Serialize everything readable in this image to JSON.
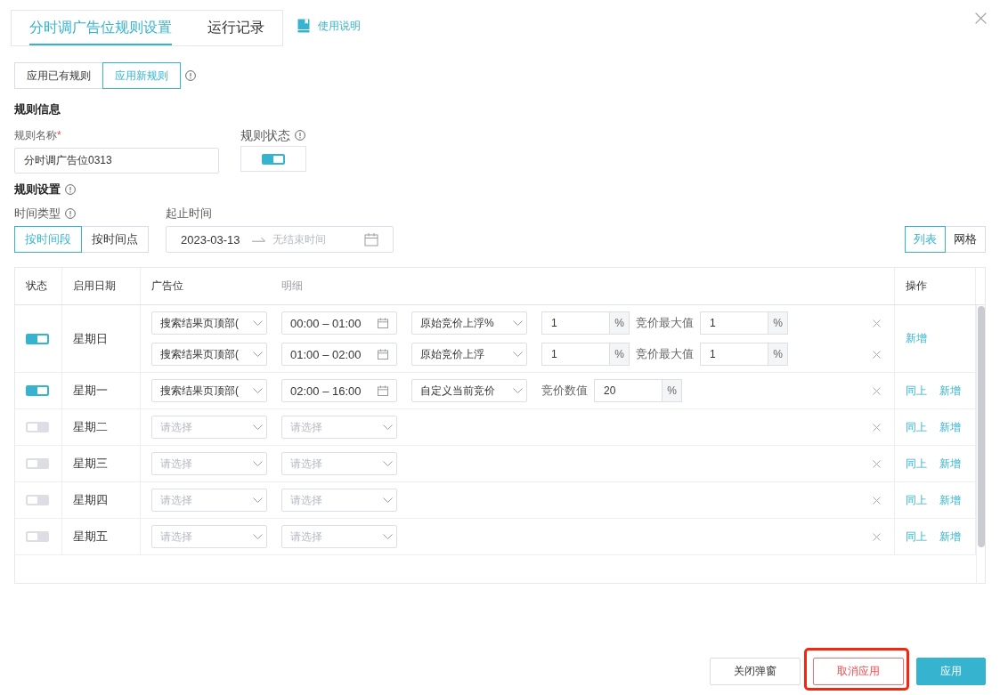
{
  "tabs": [
    {
      "label": "分时调广告位规则设置",
      "selected": true
    },
    {
      "label": "运行记录",
      "selected": false
    }
  ],
  "help_link": {
    "label": "使用说明"
  },
  "mode_options": [
    {
      "label": "应用已有规则",
      "selected": false
    },
    {
      "label": "应用新规则",
      "selected": true
    }
  ],
  "rule_info": {
    "title": "规则信息",
    "name_label": "规则名称",
    "required_mark": "*",
    "name_value": "分时调广告位0313",
    "status_label": "规则状态",
    "status_on": true
  },
  "rule_settings": {
    "title": "规则设置",
    "time_type_label": "时间类型",
    "time_types": [
      {
        "label": "按时间段",
        "selected": true
      },
      {
        "label": "按时间点",
        "selected": false
      }
    ],
    "period_label": "起止时间",
    "start_date": "2023-03-13",
    "end_placeholder": "无结束时间",
    "views": [
      {
        "label": "列表",
        "selected": true
      },
      {
        "label": "网格",
        "selected": false
      }
    ]
  },
  "table": {
    "columns": [
      {
        "label": "状态",
        "kind": "main"
      },
      {
        "label": "启用日期",
        "kind": "main"
      },
      {
        "label": "广告位",
        "kind": "main"
      },
      {
        "label": "明细",
        "kind": "sub"
      },
      {
        "label": "操作",
        "kind": "main"
      }
    ],
    "rows": [
      {
        "on": true,
        "day": "星期日",
        "lines": [
          {
            "kind": "float",
            "slot": "搜索结果页顶部(",
            "time": "00:00 – 01:00",
            "mode": "原始竞价上浮%",
            "value": "1",
            "unit": "%",
            "max_label": "竞价最大值",
            "max_value": "1",
            "max_unit": "%"
          },
          {
            "kind": "float",
            "slot": "搜索结果页顶部(",
            "time": "01:00 – 02:00",
            "mode": "原始竞价上浮",
            "value": "1",
            "unit": "%",
            "max_label": "竞价最大值",
            "max_value": "1",
            "max_unit": "%"
          }
        ],
        "actions": [
          "新增"
        ]
      },
      {
        "on": true,
        "day": "星期一",
        "lines": [
          {
            "kind": "custom",
            "slot": "搜索结果页顶部(",
            "time": "02:00 – 16:00",
            "mode": "自定义当前竞价",
            "value_label": "竞价数值",
            "value": "20",
            "unit": "%"
          }
        ],
        "actions": [
          "同上",
          "新增"
        ]
      },
      {
        "on": false,
        "day": "星期二",
        "lines": [
          {
            "kind": "empty",
            "slot_placeholder": "请选择",
            "time_placeholder": "请选择"
          }
        ],
        "actions": [
          "同上",
          "新增"
        ]
      },
      {
        "on": false,
        "day": "星期三",
        "lines": [
          {
            "kind": "empty",
            "slot_placeholder": "请选择",
            "time_placeholder": "请选择"
          }
        ],
        "actions": [
          "同上",
          "新增"
        ]
      },
      {
        "on": false,
        "day": "星期四",
        "lines": [
          {
            "kind": "empty",
            "slot_placeholder": "请选择",
            "time_placeholder": "请选择"
          }
        ],
        "actions": [
          "同上",
          "新增"
        ]
      },
      {
        "on": false,
        "day": "星期五",
        "lines": [
          {
            "kind": "empty",
            "slot_placeholder": "请选择",
            "time_placeholder": "请选择"
          }
        ],
        "actions": [
          "同上",
          "新增"
        ]
      }
    ]
  },
  "buttons": [
    {
      "label": "关闭弹窗",
      "kind": "default",
      "highlighted": false
    },
    {
      "label": "取消应用",
      "kind": "danger",
      "highlighted": true
    },
    {
      "label": "应用",
      "kind": "primary",
      "highlighted": false
    }
  ]
}
